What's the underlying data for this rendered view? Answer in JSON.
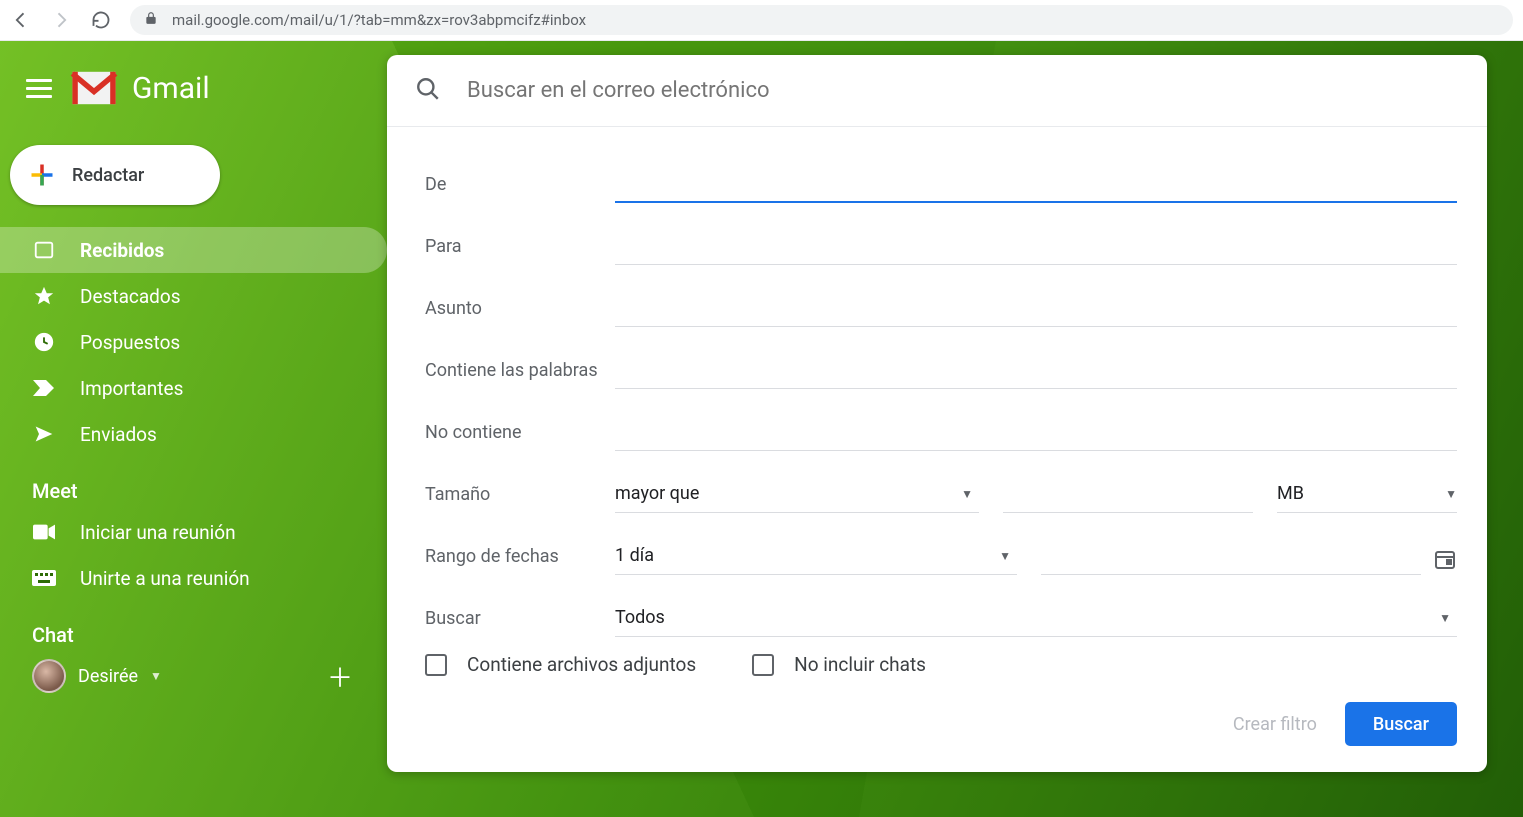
{
  "browser": {
    "url_host": "mail.google.com",
    "url_path": "/mail/u/1/?tab=mm&zx=rov3abpmcifz#inbox"
  },
  "header": {
    "app_name": "Gmail"
  },
  "compose_label": "Redactar",
  "nav": {
    "items": [
      {
        "label": "Recibidos",
        "icon": "inbox-icon",
        "active": true
      },
      {
        "label": "Destacados",
        "icon": "star-icon",
        "active": false
      },
      {
        "label": "Pospuestos",
        "icon": "clock-icon",
        "active": false
      },
      {
        "label": "Importantes",
        "icon": "importance-icon",
        "active": false
      },
      {
        "label": "Enviados",
        "icon": "send-icon",
        "active": false
      }
    ]
  },
  "meet": {
    "title": "Meet",
    "items": [
      {
        "label": "Iniciar una reunión",
        "icon": "video-icon"
      },
      {
        "label": "Unirte a una reunión",
        "icon": "keyboard-icon"
      }
    ]
  },
  "chat": {
    "title": "Chat",
    "user_name": "Desirée"
  },
  "search": {
    "placeholder": "Buscar en el correo electrónico",
    "filters": {
      "from_label": "De",
      "to_label": "Para",
      "subject_label": "Asunto",
      "has_words_label": "Contiene las palabras",
      "not_has_label": "No contiene",
      "size_label": "Tamaño",
      "size_operator": "mayor que",
      "size_unit": "MB",
      "date_label": "Rango de fechas",
      "date_range": "1 día",
      "search_in_label": "Buscar",
      "search_in_value": "Todos",
      "has_attachment_label": "Contiene archivos adjuntos",
      "exclude_chats_label": "No incluir chats"
    },
    "actions": {
      "create_filter": "Crear filtro",
      "search": "Buscar"
    }
  }
}
